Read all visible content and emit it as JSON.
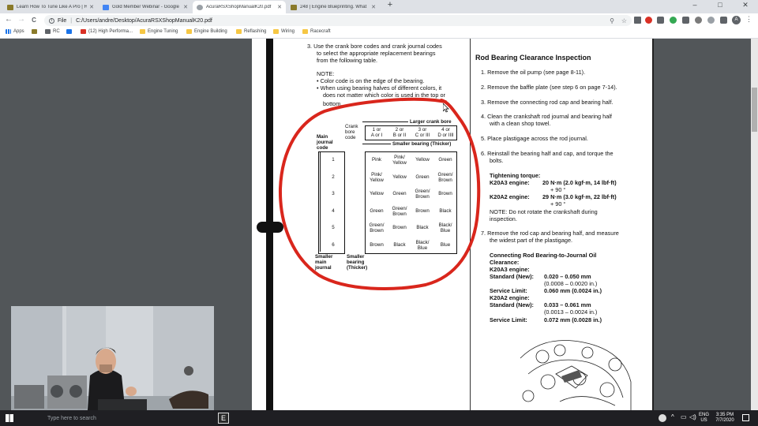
{
  "browser": {
    "tabs": [
      {
        "label": "Learn How To Tune Like A Pro | H",
        "color": "#8a7a2a",
        "active": false
      },
      {
        "label": "Gold Member Webinar - Google",
        "color": "#4285f4",
        "active": false
      },
      {
        "label": "AcuraRSXShopManualK20.pdf",
        "color": "#9aa0a6",
        "active": true
      },
      {
        "label": "248 | Engine Blueprinting. What",
        "color": "#8a7a2a",
        "active": false
      }
    ],
    "new_tab": "+",
    "window_controls": [
      "–",
      "□",
      "✕"
    ],
    "nav": {
      "back": "←",
      "forward": "→",
      "reload": "C"
    },
    "omnibox": {
      "scheme_label": "File",
      "url": "C:/Users/andre/Desktop/AcuraRSXShopManualK20.pdf"
    },
    "bookmarks": [
      {
        "label": "Apps",
        "type": "apps"
      },
      {
        "label": "",
        "type": "site"
      },
      {
        "label": "RC",
        "type": "site"
      },
      {
        "label": "",
        "type": "site"
      },
      {
        "label": "(12) High Performa...",
        "type": "site"
      },
      {
        "label": "Engine Tuning",
        "type": "folder"
      },
      {
        "label": "Engine Building",
        "type": "folder"
      },
      {
        "label": "Reflashing",
        "type": "folder"
      },
      {
        "label": "Wiring",
        "type": "folder"
      },
      {
        "label": "Racecraft",
        "type": "folder"
      }
    ],
    "profile_initial": "A"
  },
  "pdf": {
    "left": {
      "step3": [
        "3.  Use the crank bore codes and crank journal codes",
        "to select the appropriate replacement bearings",
        "from the following table."
      ],
      "note_title": "NOTE:",
      "note_lines": [
        "• Color code is on the edge of the bearing.",
        "• When using bearing halves of different colors, it",
        "does not matter which color is used in the top or",
        "bottom."
      ],
      "table": {
        "larger_crank_bore": "Larger crank bore",
        "crank_bore_code_label": [
          "Crank",
          "bore",
          "code"
        ],
        "main_journal_code_label": [
          "Main",
          "journal",
          "code"
        ],
        "smaller_bearing": "Smaller bearing (Thicker)",
        "col_headers": [
          [
            "1 or",
            "A or I"
          ],
          [
            "2 or",
            "B or II"
          ],
          [
            "3 or",
            "C or III"
          ],
          [
            "4 or",
            "D or IIII"
          ]
        ],
        "row_codes": [
          "1",
          "2",
          "3",
          "4",
          "5",
          "6"
        ],
        "cells": [
          [
            [
              "Pink"
            ],
            [
              "Pink/",
              "Yellow"
            ],
            [
              "Yellow"
            ],
            [
              "Green"
            ]
          ],
          [
            [
              "Pink/",
              "Yellow"
            ],
            [
              "Yellow"
            ],
            [
              "Green"
            ],
            [
              "Green/",
              "Brown"
            ]
          ],
          [
            [
              "Yellow"
            ],
            [
              "Green"
            ],
            [
              "Green/",
              "Brown"
            ],
            [
              "Brown"
            ]
          ],
          [
            [
              "Green"
            ],
            [
              "Green/",
              "Brown"
            ],
            [
              "Brown"
            ],
            [
              "Black"
            ]
          ],
          [
            [
              "Green/",
              "Brown"
            ],
            [
              "Brown"
            ],
            [
              "Black"
            ],
            [
              "Black/",
              "Blue"
            ]
          ],
          [
            [
              "Brown"
            ],
            [
              "Black"
            ],
            [
              "Black/",
              "Blue"
            ],
            [
              "Blue"
            ]
          ]
        ],
        "smaller_main_journal": [
          "Smaller",
          "main",
          "journal"
        ],
        "smaller_bearing_thicker": [
          "Smaller",
          "bearing",
          "(Thicker)"
        ]
      }
    },
    "right": {
      "title": "Rod Bearing Clearance Inspection",
      "steps": [
        [
          "1.  Remove the oil pump (see page 8-11)."
        ],
        [
          "2.  Remove the baffle plate (see step 6 on page 7-14)."
        ],
        [
          "3.  Remove the connecting rod cap and bearing half."
        ],
        [
          "4.  Clean the crankshaft rod journal and bearing half",
          "with a clean shop towel."
        ],
        [
          "5.  Place plastigage across the rod journal."
        ],
        [
          "6.  Reinstall the bearing half and cap, and torque the",
          "bolts."
        ]
      ],
      "torque_title": "Tightening torque:",
      "k20a3_label": "K20A3 engine:",
      "k20a3_value": "20 N·m (2.0 kgf·m, 14 lbf·ft)",
      "k20a3_angle": "+ 90 °",
      "k20a2_label": "K20A2 engine:",
      "k20a2_value": "29 N·m (3.0 kgf·m, 22 lbf·ft)",
      "k20a2_angle": "+ 90 °",
      "note": [
        "NOTE: Do not rotate the crankshaft during",
        "inspection."
      ],
      "step7": [
        "7.  Remove the rod cap and bearing half, and measure",
        "the widest part of the plastigage."
      ],
      "clearance_title": [
        "Connecting Rod Bearing-to-Journal Oil",
        "Clearance:"
      ],
      "k20a3_engine": "K20A3 engine:",
      "std_new_label": "Standard (New):",
      "k20a3_std": [
        "0.020 – 0.050 mm",
        "(0.0008 – 0.0020 in.)"
      ],
      "service_limit_label": "Service Limit:",
      "k20a3_limit": "0.060 mm (0.0024 in.)",
      "k20a2_engine": "K20A2 engine:",
      "k20a2_std": [
        "0.033 – 0.061 mm",
        "(0.0013 – 0.0024 in.)"
      ],
      "k20a2_limit": "0.072 mm (0.0028 in.)"
    }
  },
  "taskbar": {
    "search_placeholder": "Type here to search",
    "lang": "ENG",
    "region": "US",
    "time": "3:35 PM",
    "date": "7/7/2020"
  },
  "colors": {
    "annotation": "#d9261c",
    "tab_strip": "#dee1e6",
    "taskbar": "#1f1f23"
  }
}
